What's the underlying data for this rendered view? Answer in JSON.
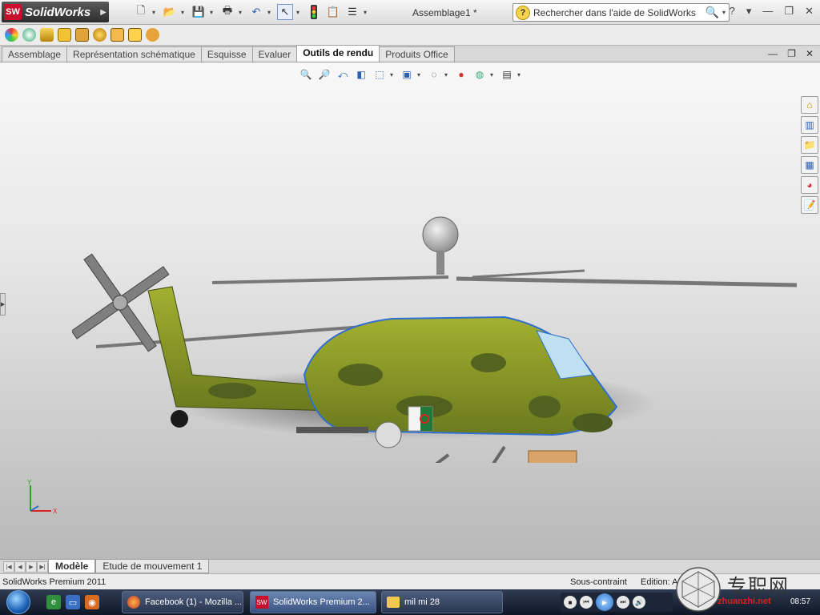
{
  "app": {
    "brand": "SolidWorks",
    "logo_letters": "SW",
    "document_title": "Assemblage1 *"
  },
  "search": {
    "placeholder": "Rechercher dans l'aide de SolidWorks"
  },
  "title_controls": {
    "help": "?"
  },
  "command_tabs": [
    {
      "label": "Assemblage"
    },
    {
      "label": "Représentation schématique"
    },
    {
      "label": "Esquisse"
    },
    {
      "label": "Evaluer"
    },
    {
      "label": "Outils de rendu",
      "active": true
    },
    {
      "label": "Produits Office"
    }
  ],
  "bottom_tabs": [
    {
      "label": "Modèle",
      "active": true
    },
    {
      "label": "Etude de mouvement 1"
    }
  ],
  "status": {
    "product": "SolidWorks Premium 2011",
    "constraint": "Sous-contraint",
    "edition": "Edition: A"
  },
  "taskbar": {
    "items": [
      {
        "label": "Facebook (1) - Mozilla ..."
      },
      {
        "label": "SolidWorks Premium 2...",
        "active": true
      },
      {
        "label": "mil mi 28"
      }
    ]
  },
  "watermark": {
    "title": "专职网",
    "sub": "zhuanzhi.net",
    "time": "08:57"
  },
  "triad": {
    "y": "Y",
    "x": "X"
  },
  "colors": {
    "camo_green": "#8c9a2a",
    "camo_dark": "#4b5a1e",
    "accent_blue": "#2f6fd0",
    "brand_red": "#c8102e"
  }
}
